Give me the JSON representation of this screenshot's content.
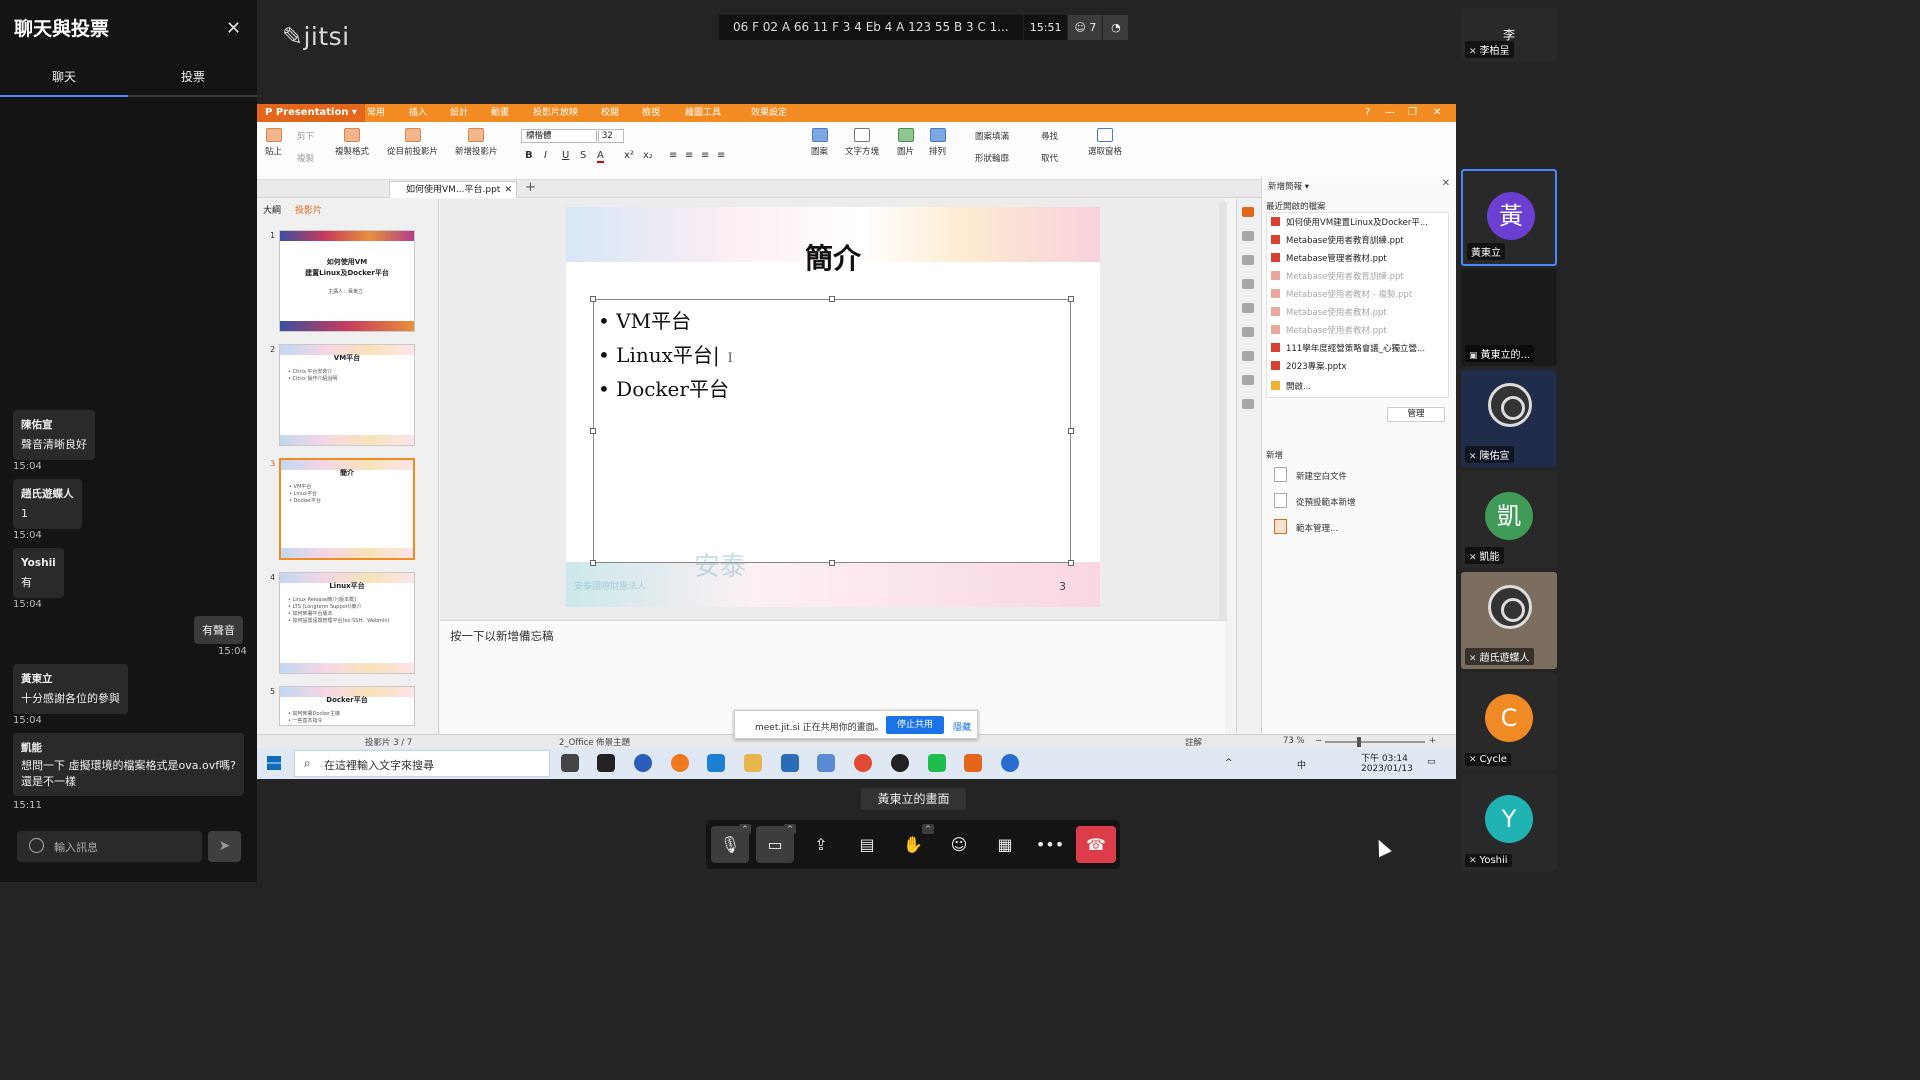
{
  "chat_panel": {
    "title": "聊天與投票",
    "tabs": [
      "聊天",
      "投票"
    ],
    "messages": [
      {
        "sender": "陳佑宣",
        "text": "聲音清晰良好",
        "time": "15:04"
      },
      {
        "sender": "趙氏遊蝶人",
        "text": "1",
        "time": "15:04"
      },
      {
        "sender": "Yoshii",
        "text": "有",
        "time": "15:04"
      },
      {
        "sender": "",
        "text": "有聲音",
        "time": "15:04",
        "own": true
      },
      {
        "sender": "黃東立",
        "text": "十分感謝各位的參與",
        "time": "15:04"
      },
      {
        "sender": "凱能",
        "text": "想問一下 虛擬環境的檔案格式是ova.ovf嗎? 還是不一樣",
        "time": "15:11"
      }
    ],
    "input_placeholder": "輸入訊息"
  },
  "meeting": {
    "logo": "jitsi",
    "subject": "06 F 02 A 66 11 F 3 4 Eb 4 A 123 55 B 3 C 1...",
    "clock": "15:51",
    "participants_count": "7",
    "screen_label": "黃東立的畫面",
    "share_notice": "meet.jit.si 正在共用你的畫面。",
    "stop_share": "停止共用",
    "hide": "隱藏"
  },
  "presentation": {
    "app_name": "Presentation",
    "menu": [
      "常用",
      "插入",
      "設計",
      "動畫",
      "投影片放映",
      "校閱",
      "檢視",
      "繪圖工具",
      "效果設定"
    ],
    "ribbon": {
      "paste": "貼上",
      "cut": "剪下",
      "copy": "複製",
      "format_painter": "複製格式",
      "from_current": "從目前投影片",
      "new_slide": "新增投影片",
      "font_name": "標楷體",
      "font_size": "32",
      "shapes": "圖案",
      "textbox": "文字方塊",
      "picture": "圖片",
      "arrange": "排列",
      "fill": "圖案填滿",
      "outline": "形狀輪廓",
      "find": "尋找",
      "replace": "取代",
      "select_pane": "選取窗格"
    },
    "file_tab": "如何使用VM...平台.ppt",
    "panel_tabs": [
      "大綱",
      "投影片"
    ],
    "thumbnails": [
      {
        "num": "1",
        "title": "如何使用VM\n建置Linux及Docker平台",
        "lines": [
          "主講人：黃東立"
        ]
      },
      {
        "num": "2",
        "title": "VM平台",
        "lines": [
          "• Citrix 平台安裝介",
          "• Citrix 操作介紹說明"
        ]
      },
      {
        "num": "3",
        "title": "簡介",
        "lines": [
          "• VM平台",
          "• Linux平台",
          "• Docker平台"
        ]
      },
      {
        "num": "4",
        "title": "Linux平台",
        "lines": [
          "• Linux Release簡介(版本概)",
          "• LTS (Longterm Support)簡介",
          "• 如何佈署平台版本",
          "• 如何設置遠端管理平台(ex:SSH、Webmin)"
        ]
      },
      {
        "num": "5",
        "title": "Docker平台",
        "lines": [
          "• 如何佈署Docker主機",
          "• 一些基本指令"
        ]
      }
    ],
    "slide": {
      "title": "簡介",
      "bullets": [
        "VM平台",
        "Linux平台",
        "Docker平台"
      ],
      "page_number": "3",
      "watermark": "安泰",
      "watermark_small": "安泰國際財團法人"
    },
    "notes_placeholder": "按一下以新增備忘稿",
    "task_pane": {
      "title": "新增簡報",
      "recent_header": "最近開啟的檔案",
      "recent_files": [
        {
          "name": "如何使用VM建置Linux及Docker平...",
          "dim": false
        },
        {
          "name": "Metabase使用者教育訓練.ppt",
          "dim": false
        },
        {
          "name": "Metabase管理者教材.ppt",
          "dim": false
        },
        {
          "name": "Metabase使用者教育訓練.ppt",
          "dim": true
        },
        {
          "name": "Metabase使用者教材 - 複製.ppt",
          "dim": true
        },
        {
          "name": "Metabase使用者教材.ppt",
          "dim": true
        },
        {
          "name": "Metabase使用者教材.ppt",
          "dim": true
        },
        {
          "name": "111學年度經營策略會議_心獨立營...",
          "dim": false
        },
        {
          "name": "2023專案.pptx",
          "dim": false
        },
        {
          "name": "開啟...",
          "dim": false
        }
      ],
      "manage": "管理",
      "new_header": "新增",
      "new_items": [
        "新建空白文件",
        "從預設範本新增",
        "範本管理..."
      ]
    },
    "status": {
      "slide_pos": "投影片 3 / 7",
      "theme": "2_Office 佈景主題",
      "comments": "註解",
      "zoom": "73 %"
    },
    "taskbar": {
      "search_placeholder": "在這裡輸入文字來搜尋",
      "time": "下午 03:14",
      "date": "2023/01/13",
      "ime": "中"
    }
  },
  "participants": [
    {
      "name": "李柏呈",
      "initial": "李",
      "color": "#d9534f"
    },
    {
      "name": "黃東立",
      "initial": "黃",
      "color": "#6a3fd1",
      "active": true
    },
    {
      "name": "黃東立的...",
      "initial": "",
      "color": "#1e1e1e"
    },
    {
      "name": "陳佑宣",
      "initial": "",
      "color": "#2a2a2a"
    },
    {
      "name": "凱能",
      "initial": "凱",
      "color": "#3f9b57"
    },
    {
      "name": "趙氏遊蝶人",
      "initial": "",
      "color": "#8a7b6a"
    },
    {
      "name": "Cycle",
      "initial": "C",
      "color": "#f08a24"
    },
    {
      "name": "Yoshii",
      "initial": "Y",
      "color": "#1fb3b3"
    }
  ]
}
